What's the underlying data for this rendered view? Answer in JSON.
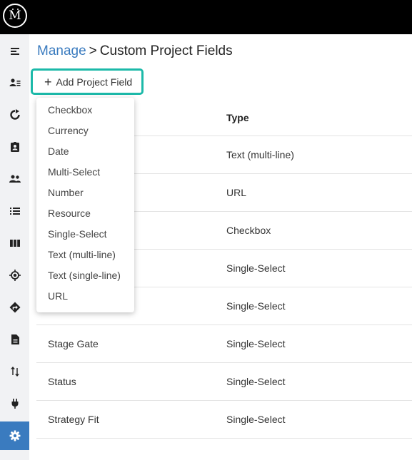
{
  "app": {
    "logo_text": "M"
  },
  "sidebar": {
    "items": [
      {
        "icon": "menu-collapse-icon"
      },
      {
        "icon": "contact-list-icon"
      },
      {
        "icon": "refresh-icon"
      },
      {
        "icon": "clipboard-user-icon"
      },
      {
        "icon": "people-icon"
      },
      {
        "icon": "list-icon"
      },
      {
        "icon": "columns-icon"
      },
      {
        "icon": "target-icon"
      },
      {
        "icon": "directions-icon"
      },
      {
        "icon": "document-icon"
      },
      {
        "icon": "sort-arrows-icon"
      },
      {
        "icon": "plug-icon"
      },
      {
        "icon": "gear-icon",
        "active": true
      }
    ]
  },
  "breadcrumb": {
    "parent": "Manage",
    "separator": ">",
    "current": "Custom Project Fields"
  },
  "toolbar": {
    "add_label": "Add Project Field"
  },
  "table": {
    "headers": {
      "type": "Type"
    },
    "rows": [
      {
        "name": "",
        "type": "Text (multi-line)"
      },
      {
        "name": "",
        "type": "URL"
      },
      {
        "name": "",
        "type": "Checkbox"
      },
      {
        "name": "",
        "type": "Single-Select"
      },
      {
        "name": "",
        "type": "Single-Select"
      },
      {
        "name": "Stage Gate",
        "type": "Single-Select"
      },
      {
        "name": "Status",
        "type": "Single-Select"
      },
      {
        "name": "Strategy Fit",
        "type": "Single-Select"
      }
    ]
  },
  "dropdown": {
    "items": [
      "Checkbox",
      "Currency",
      "Date",
      "Multi-Select",
      "Number",
      "Resource",
      "Single-Select",
      "Text (multi-line)",
      "Text (single-line)",
      "URL"
    ]
  },
  "colors": {
    "accent": "#3a7bbf",
    "highlight": "#1cb9a9",
    "topbar": "#000000",
    "sidebar": "#f1f2f4"
  }
}
